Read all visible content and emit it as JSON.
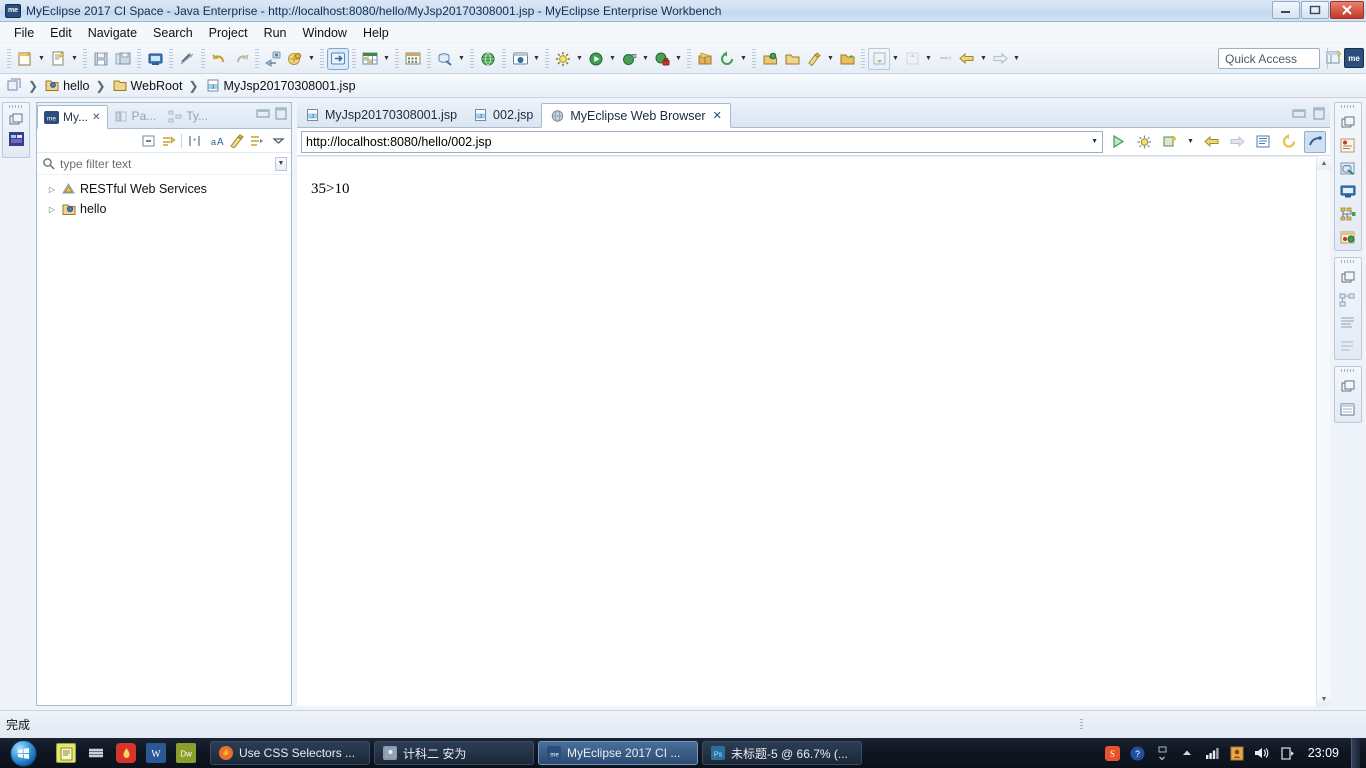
{
  "window": {
    "title": "MyEclipse 2017 CI Space - Java Enterprise - http://localhost:8080/hello/MyJsp20170308001.jsp - MyEclipse Enterprise Workbench",
    "app_icon_label": "me",
    "controls": {
      "minimize": "—",
      "maximize": "❐",
      "close": "✕"
    }
  },
  "menubar": {
    "items": [
      {
        "label": "File"
      },
      {
        "label": "Edit"
      },
      {
        "label": "Navigate"
      },
      {
        "label": "Search"
      },
      {
        "label": "Project"
      },
      {
        "label": "Run"
      },
      {
        "label": "Window"
      },
      {
        "label": "Help"
      }
    ]
  },
  "toolbar": {
    "quick_access_placeholder": "Quick Access",
    "perspective_label": "me",
    "groups": [
      {
        "buttons": [
          {
            "name": "new-wizard-icon",
            "arrow": true
          },
          {
            "name": "new-java-file-icon",
            "arrow": true
          }
        ]
      },
      {
        "buttons": [
          {
            "name": "save-icon",
            "arrow": false
          },
          {
            "name": "save-all-icon",
            "arrow": false
          }
        ]
      },
      {
        "buttons": [
          {
            "name": "print-icon",
            "arrow": false
          }
        ]
      },
      {
        "buttons": [
          {
            "name": "toggle-breakpoint-icon",
            "arrow": false
          }
        ]
      },
      {
        "buttons": [
          {
            "name": "undo-icon",
            "arrow": false
          },
          {
            "name": "redo-icon",
            "arrow": false
          }
        ]
      },
      {
        "buttons": [
          {
            "name": "deploy-icon",
            "arrow": false
          },
          {
            "name": "servers-icon",
            "arrow": true
          }
        ]
      },
      {
        "buttons": [
          {
            "name": "run-as-web-icon",
            "arrow": false
          }
        ]
      },
      {
        "buttons": [
          {
            "name": "table-icon",
            "arrow": true
          },
          {
            "name": "grid-icon",
            "arrow": false
          }
        ]
      },
      {
        "buttons": [
          {
            "name": "db-browser-icon",
            "arrow": true
          }
        ]
      },
      {
        "buttons": [
          {
            "name": "globe-icon",
            "arrow": false
          }
        ]
      },
      {
        "buttons": [
          {
            "name": "web-browser-icon",
            "arrow": true
          }
        ]
      },
      {
        "buttons": [
          {
            "name": "external-tools-icon",
            "arrow": true
          }
        ]
      },
      {
        "buttons": [
          {
            "name": "run-icon",
            "arrow": true
          },
          {
            "name": "debug-icon",
            "arrow": true
          },
          {
            "name": "profile-icon",
            "arrow": true
          }
        ]
      },
      {
        "buttons": [
          {
            "name": "new-package-icon",
            "arrow": false
          },
          {
            "name": "refresh-icon",
            "arrow": true
          }
        ]
      },
      {
        "buttons": [
          {
            "name": "open-type-icon",
            "arrow": false
          },
          {
            "name": "open-resource-icon",
            "arrow": false
          },
          {
            "name": "search-icon",
            "arrow": true
          },
          {
            "name": "open-folder-icon",
            "arrow": false
          }
        ]
      },
      {
        "buttons": [
          {
            "name": "next-annotation-icon",
            "arrow": true
          },
          {
            "name": "previous-annotation-icon",
            "arrow": true
          }
        ]
      },
      {
        "buttons": [
          {
            "name": "back-history-icon",
            "arrow": true
          },
          {
            "name": "forward-history-icon",
            "arrow": true
          }
        ]
      }
    ]
  },
  "breadcrumb": {
    "home_icon": "workspace-icon",
    "items": [
      {
        "icon": "project-icon",
        "label": "hello"
      },
      {
        "icon": "folder-icon",
        "label": "WebRoot"
      },
      {
        "icon": "jsp-file-icon",
        "label": "MyJsp20170308001.jsp"
      }
    ],
    "separator": "❯"
  },
  "left_fastbar": {
    "items": [
      {
        "name": "restore-view-icon"
      },
      {
        "name": "myeclipse-explorer-icon"
      }
    ]
  },
  "explorer": {
    "tabs": [
      {
        "label": "My...",
        "icon": "myeclipse-icon",
        "active": true,
        "closable": true
      },
      {
        "label": "Pa...",
        "icon": "package-explorer-icon",
        "active": false,
        "closable": false
      },
      {
        "label": "Ty...",
        "icon": "type-hierarchy-icon",
        "active": false,
        "closable": false
      }
    ],
    "view_buttons": [
      {
        "name": "minimize-view-icon"
      },
      {
        "name": "maximize-view-icon"
      }
    ],
    "toolbar_buttons": [
      {
        "name": "collapse-all-icon"
      },
      {
        "name": "link-with-editor-icon"
      },
      {
        "name": "filters-icon"
      },
      {
        "name": "sort-alpha-icon"
      },
      {
        "name": "highlight-icon"
      },
      {
        "name": "configure-icon"
      },
      {
        "name": "view-menu-icon"
      }
    ],
    "filter": {
      "placeholder": "type filter text",
      "icon": "search-icon",
      "dropdown_icon": "chevron-down-icon"
    },
    "tree": [
      {
        "label": "RESTful Web Services",
        "icon": "restful-service-icon",
        "expanded": false,
        "twisty": "▷"
      },
      {
        "label": "hello",
        "icon": "web-project-icon",
        "expanded": false,
        "twisty": "▷"
      }
    ]
  },
  "editor": {
    "tabs": [
      {
        "label": "MyJsp20170308001.jsp",
        "icon": "jsp-file-icon",
        "active": false,
        "closable": false
      },
      {
        "label": "002.jsp",
        "icon": "jsp-file-icon",
        "active": false,
        "closable": false
      },
      {
        "label": "MyEclipse Web Browser",
        "icon": "browser-globe-icon",
        "active": true,
        "closable": true
      }
    ],
    "view_buttons": [
      {
        "name": "minimize-editor-icon"
      },
      {
        "name": "maximize-editor-icon"
      }
    ]
  },
  "browser": {
    "address": {
      "value": "http://localhost:8080/hello/002.jsp",
      "dropdown_icon": "chevron-down-icon"
    },
    "buttons": [
      {
        "name": "go-icon"
      },
      {
        "name": "debug-page-icon"
      },
      {
        "name": "new-window-icon",
        "arrow": true
      },
      {
        "name": "back-icon"
      },
      {
        "name": "forward-icon"
      },
      {
        "name": "stop-icon"
      },
      {
        "name": "refresh-icon"
      },
      {
        "name": "link-ui-icon"
      }
    ],
    "page_text": "35>10",
    "scrollbar": {
      "up_icon": "▲",
      "down_icon": "▼"
    }
  },
  "right_fastbar": {
    "groups": [
      {
        "items": [
          {
            "name": "restore-view-icon"
          },
          {
            "name": "outline-view-icon"
          },
          {
            "name": "myeclipse-db-icon"
          },
          {
            "name": "console-view-icon"
          },
          {
            "name": "servers-view-icon"
          },
          {
            "name": "snippets-view-icon"
          }
        ]
      },
      {
        "items": [
          {
            "name": "restore-view-icon"
          },
          {
            "name": "hierarchy-view-icon"
          },
          {
            "name": "properties-view-icon"
          },
          {
            "name": "tasks-view-icon"
          }
        ]
      },
      {
        "items": [
          {
            "name": "restore-view-icon"
          },
          {
            "name": "overview-view-icon"
          }
        ]
      }
    ]
  },
  "statusbar": {
    "text": "完成"
  },
  "taskbar": {
    "start_label": "",
    "quick_launch": [
      {
        "name": "notepad-icon",
        "color": "#d9e04a"
      },
      {
        "name": "media-icon",
        "color": "#c0c6d2"
      },
      {
        "name": "antivirus-icon",
        "color": "#e23b2e"
      },
      {
        "name": "word-icon",
        "color": "#2b5797"
      },
      {
        "name": "dreamweaver-icon",
        "color": "#7a9a1e"
      }
    ],
    "tasks": [
      {
        "label": "Use CSS Selectors ...",
        "icon": "firefox-icon",
        "active": false
      },
      {
        "label": "计科二  安为",
        "icon": "explorer-icon",
        "active": false
      },
      {
        "label": "MyEclipse 2017 CI ...",
        "icon": "myeclipse-icon",
        "active": true
      },
      {
        "label": "未标题-5 @ 66.7% (...",
        "icon": "photoshop-icon",
        "active": false
      }
    ],
    "tray": [
      {
        "name": "sogou-input-icon"
      },
      {
        "name": "help-icon"
      },
      {
        "name": "show-hidden-icons-icon"
      },
      {
        "name": "tray-expand-icon"
      },
      {
        "name": "network-icon"
      },
      {
        "name": "security-icon"
      },
      {
        "name": "volume-icon"
      },
      {
        "name": "action-center-icon"
      }
    ],
    "clock": "23:09"
  }
}
